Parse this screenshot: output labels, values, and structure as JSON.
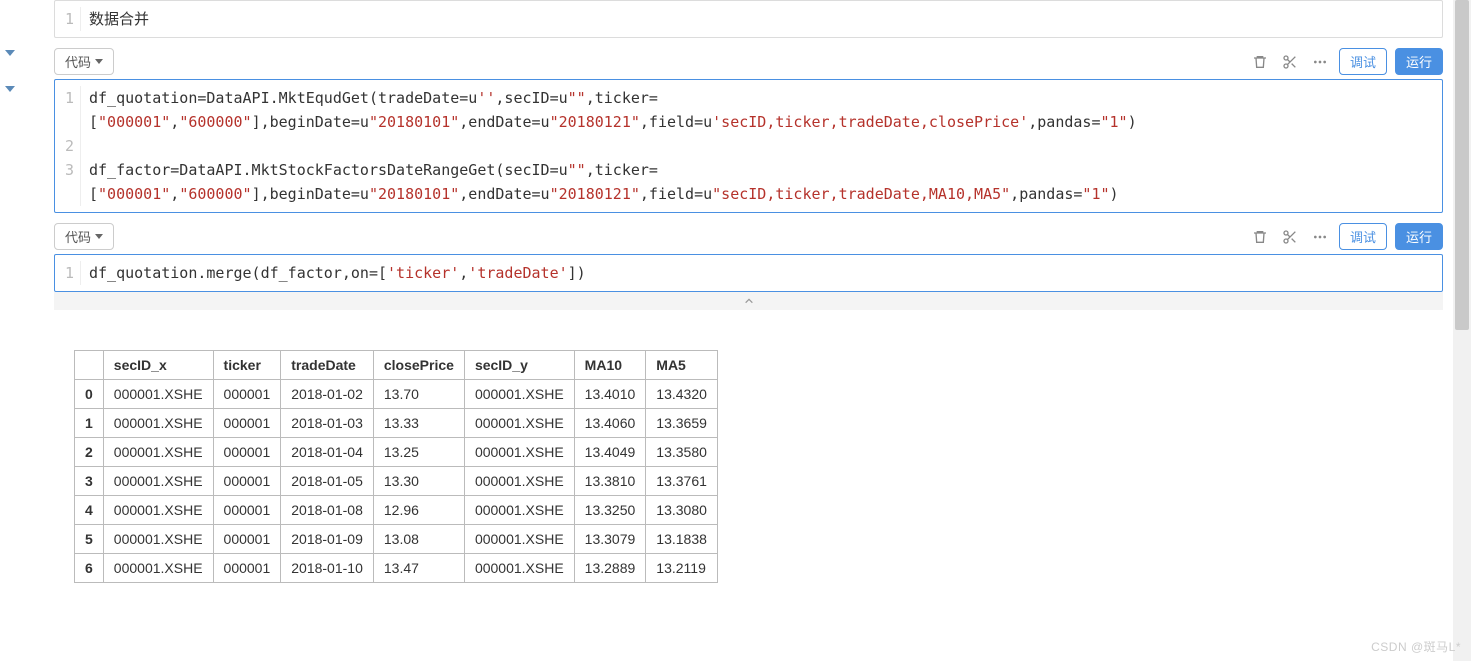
{
  "toolbar": {
    "code_label": "代码",
    "debug_label": "调试",
    "run_label": "运行"
  },
  "cell_top": {
    "line1": "数据合并"
  },
  "cell1": {
    "lines": {
      "l1": {
        "pre": "df_quotation=DataAPI.MktEqudGet(tradeDate=u",
        "s1": "''",
        "mid1": ",secID=u",
        "s2": "\"\"",
        "mid2": ",ticker="
      },
      "l1b": {
        "open": "[",
        "a1": "\"000001\"",
        "comma1": ",",
        "a2": "\"600000\"",
        "closeb": "],beginDate=u",
        "s3": "\"20180101\"",
        "mid3": ",endDate=u",
        "s4": "\"20180121\"",
        "mid4": ",field=u",
        "s5": "'secID,ticker,tradeDate,closePrice'",
        "mid5": ",pandas=",
        "s6": "\"1\"",
        "close": ")"
      },
      "l3": {
        "pre": "df_factor=DataAPI.MktStockFactorsDateRangeGet(secID=u",
        "s1": "\"\"",
        "mid1": ",ticker="
      },
      "l3b": {
        "open": "[",
        "a1": "\"000001\"",
        "comma1": ",",
        "a2": "\"600000\"",
        "closeb": "],beginDate=u",
        "s3": "\"20180101\"",
        "mid3": ",endDate=u",
        "s4": "\"20180121\"",
        "mid4": ",field=u",
        "s5": "\"secID,ticker,tradeDate,MA10,MA5\"",
        "mid5": ",pandas=",
        "s6": "\"1\"",
        "close": ")"
      }
    }
  },
  "cell2": {
    "l1": {
      "pre": "df_quotation.merge(df_factor,on=[",
      "s1": "'ticker'",
      "comma": ",",
      "s2": "'tradeDate'",
      "close": "])"
    }
  },
  "table": {
    "headers": [
      "secID_x",
      "ticker",
      "tradeDate",
      "closePrice",
      "secID_y",
      "MA10",
      "MA5"
    ],
    "rows": [
      {
        "idx": "0",
        "secID_x": "000001.XSHE",
        "ticker": "000001",
        "tradeDate": "2018-01-02",
        "closePrice": "13.70",
        "secID_y": "000001.XSHE",
        "MA10": "13.4010",
        "MA5": "13.4320"
      },
      {
        "idx": "1",
        "secID_x": "000001.XSHE",
        "ticker": "000001",
        "tradeDate": "2018-01-03",
        "closePrice": "13.33",
        "secID_y": "000001.XSHE",
        "MA10": "13.4060",
        "MA5": "13.3659"
      },
      {
        "idx": "2",
        "secID_x": "000001.XSHE",
        "ticker": "000001",
        "tradeDate": "2018-01-04",
        "closePrice": "13.25",
        "secID_y": "000001.XSHE",
        "MA10": "13.4049",
        "MA5": "13.3580"
      },
      {
        "idx": "3",
        "secID_x": "000001.XSHE",
        "ticker": "000001",
        "tradeDate": "2018-01-05",
        "closePrice": "13.30",
        "secID_y": "000001.XSHE",
        "MA10": "13.3810",
        "MA5": "13.3761"
      },
      {
        "idx": "4",
        "secID_x": "000001.XSHE",
        "ticker": "000001",
        "tradeDate": "2018-01-08",
        "closePrice": "12.96",
        "secID_y": "000001.XSHE",
        "MA10": "13.3250",
        "MA5": "13.3080"
      },
      {
        "idx": "5",
        "secID_x": "000001.XSHE",
        "ticker": "000001",
        "tradeDate": "2018-01-09",
        "closePrice": "13.08",
        "secID_y": "000001.XSHE",
        "MA10": "13.3079",
        "MA5": "13.1838"
      },
      {
        "idx": "6",
        "secID_x": "000001.XSHE",
        "ticker": "000001",
        "tradeDate": "2018-01-10",
        "closePrice": "13.47",
        "secID_y": "000001.XSHE",
        "MA10": "13.2889",
        "MA5": "13.2119"
      }
    ]
  },
  "watermark": "CSDN @斑马L*"
}
